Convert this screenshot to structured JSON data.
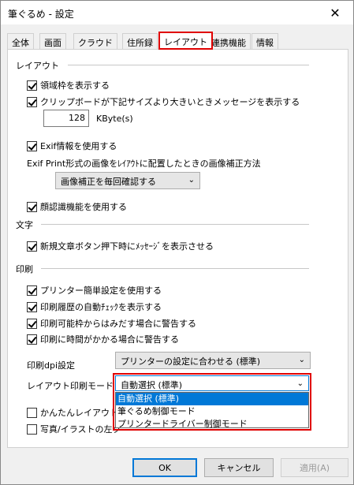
{
  "window": {
    "title": "筆ぐるめ - 設定",
    "close_glyph": "✕"
  },
  "tabs": [
    "全体",
    "画面",
    "クラウド",
    "住所録",
    "レイアウト",
    "連携機能",
    "情報"
  ],
  "active_tab": "レイアウト",
  "layout_section": {
    "title": "レイアウト",
    "show_region_frame": "領域枠を表示する",
    "clipboard_warning": "クリップボードが下記サイズより大きいときメッセージを表示する",
    "clipboard_size_value": "128",
    "clipboard_size_unit": "KByte(s)",
    "use_exif": "Exif情報を使用する",
    "exif_print_label": "Exif Print形式の画像をﾚｲｱｳﾄに配置したときの画像補正方法",
    "exif_correction_value": "画像補正を毎回確認する",
    "face_recognition": "顔認識機能を使用する"
  },
  "text_section": {
    "title": "文字",
    "new_text_message": "新規文章ボタン押下時にﾒｯｾｰｼﾞを表示させる"
  },
  "print_section": {
    "title": "印刷",
    "simple_printer_setup": "プリンター簡単設定を使用する",
    "auto_check_history": "印刷履歴の自動ﾁｪｯｸを表示する",
    "warn_out_of_area": "印刷可能枠からはみだす場合に警告する",
    "warn_long_time": "印刷に時間がかかる場合に警告する",
    "dpi_label": "印刷dpi設定",
    "dpi_value": "プリンターの設定に合わせる (標準)",
    "layout_mode_label": "レイアウト印刷モード",
    "layout_mode_value": "自動選択 (標準)",
    "layout_mode_options": [
      "自動選択 (標準)",
      "筆ぐるめ制御モード",
      "プリンタードライバー制御モード"
    ],
    "easy_layout_partial": "かんたんレイアウトを",
    "photo_illust_partial": "写真/イラストの左ク"
  },
  "buttons": {
    "ok": "OK",
    "cancel": "キャンセル",
    "apply": "適用(A)"
  },
  "colors": {
    "highlight": "#e00000",
    "selection": "#0078d7"
  }
}
